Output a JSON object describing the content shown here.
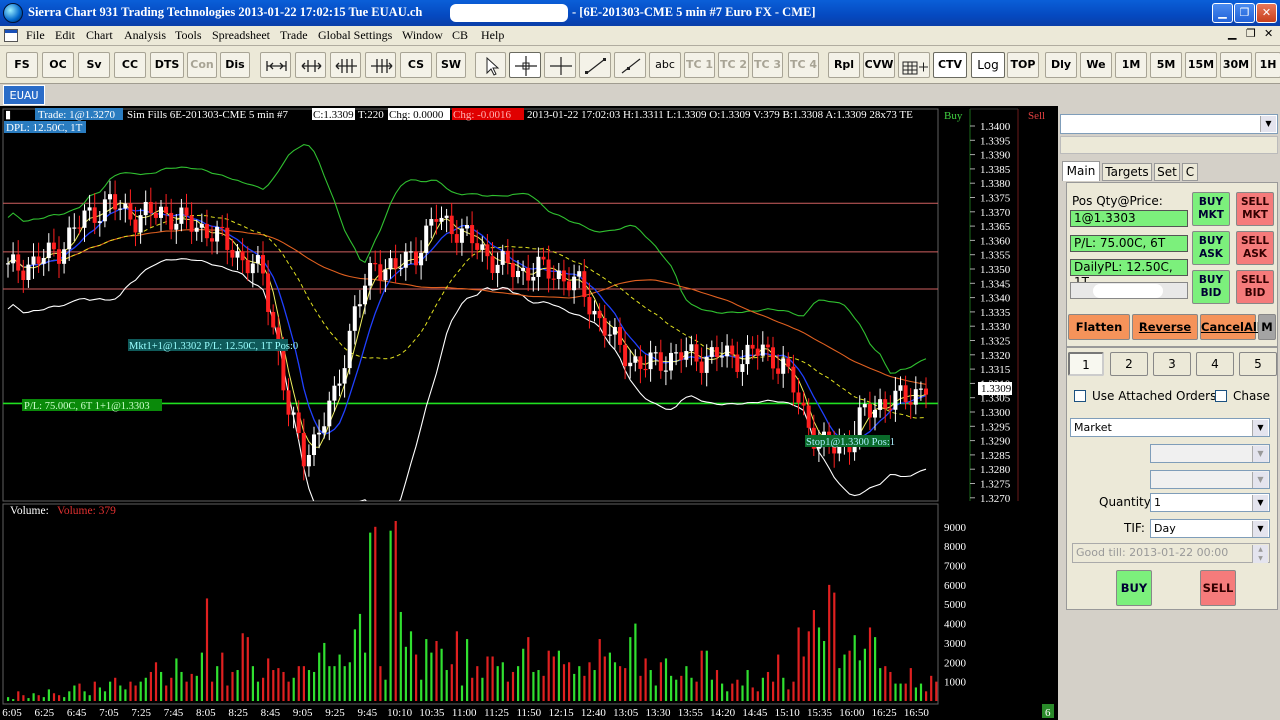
{
  "window": {
    "title_left": "Sierra Chart 931 Trading Technologies 2013-01-22  17:02:15 Tue  EUAU.ch",
    "title_right": "- [6E-201303-CME  5 min   #7  Euro FX - CME]",
    "controls": [
      "minimize-icon",
      "restore-icon",
      "close-icon"
    ]
  },
  "menu": [
    "File",
    "Edit",
    "Chart",
    "Analysis",
    "Tools",
    "Spreadsheet",
    "Trade",
    "Global Settings",
    "Window",
    "CB",
    "Help"
  ],
  "toolbar": {
    "group1": [
      "FS",
      "OC",
      "Sv",
      "CC",
      "DTS",
      "Con",
      "Dis"
    ],
    "group2": [
      "CS",
      "SW"
    ],
    "text_tool": "abc",
    "tc": [
      "TC 1",
      "TC 2",
      "TC 3",
      "TC 4"
    ],
    "group3": [
      "Rpl",
      "CVW"
    ],
    "ctv": "CTV",
    "log": "Log",
    "top": "TOP",
    "periods": [
      "Dly",
      "We",
      "1M",
      "5M",
      "15M",
      "30M",
      "1H"
    ]
  },
  "chart_tab": "EUAU",
  "chart_header": {
    "trade": "Trade: 1@1.3270",
    "sim": "Sim Fills  6E-201303-CME  5 min   #7",
    "close": "C:1.3309",
    "ticks": "T:220",
    "chg": "Chg: 0.0000",
    "chg2": "Chg: -0.0016",
    "stats": "2013-01-22 17:02:03 H:1.3311  L:1.3309  O:1.3309  V:379  B:1.3308  A:1.3309  28x73  TE",
    "dpl": "DPL: 12.50C, 1T",
    "buy": "Buy",
    "sell": "Sell"
  },
  "chart_annotations": {
    "mkt": "Mkt1+1@1.3302 P/L: 12.50C, 1T Pos:0",
    "pl": "P/L: 75.00C, 6T 1+1@1.3303",
    "stop": "Stop1@1.3300 Pos:1",
    "price_marker": "1.3309",
    "volume_label": "Volume:",
    "volume_value": "Volume: 379",
    "page_number": "6"
  },
  "chart_data": {
    "type": "candlestick",
    "symbol": "6E-201303-CME",
    "interval": "5 min",
    "price_axis_labels": [
      "1.3400",
      "1.3395",
      "1.3390",
      "1.3385",
      "1.3380",
      "1.3375",
      "1.3370",
      "1.3365",
      "1.3360",
      "1.3355",
      "1.3350",
      "1.3345",
      "1.3340",
      "1.3335",
      "1.3330",
      "1.3325",
      "1.3320",
      "1.3315",
      "1.3310",
      "1.3305",
      "1.3300",
      "1.3295",
      "1.3290",
      "1.3285",
      "1.3280",
      "1.3275",
      "1.3270"
    ],
    "volume_axis_labels": [
      "9000",
      "8000",
      "7000",
      "6000",
      "5000",
      "4000",
      "3000",
      "2000",
      "1000"
    ],
    "time_labels": [
      "6:05",
      "6:25",
      "6:45",
      "7:05",
      "7:25",
      "7:45",
      "8:05",
      "8:25",
      "8:45",
      "9:05",
      "9:25",
      "9:45",
      "10:10",
      "10:35",
      "11:00",
      "11:25",
      "11:50",
      "12:15",
      "12:40",
      "13:05",
      "13:30",
      "13:55",
      "14:20",
      "14:45",
      "15:10",
      "15:35",
      "16:00",
      "16:25",
      "16:50"
    ],
    "horizontal_levels": [
      1.3373,
      1.3356,
      1.3343
    ],
    "position_level": 1.3303,
    "last_price": 1.3309,
    "close_anchors": [
      [
        0,
        1.335
      ],
      [
        5,
        1.3352
      ],
      [
        10,
        1.3357
      ],
      [
        15,
        1.3368
      ],
      [
        20,
        1.3373
      ],
      [
        25,
        1.3368
      ],
      [
        30,
        1.337
      ],
      [
        35,
        1.3366
      ],
      [
        40,
        1.3363
      ],
      [
        45,
        1.3355
      ],
      [
        50,
        1.3348
      ],
      [
        52,
        1.333
      ],
      [
        55,
        1.33
      ],
      [
        58,
        1.3285
      ],
      [
        61,
        1.3293
      ],
      [
        64,
        1.3305
      ],
      [
        68,
        1.3335
      ],
      [
        72,
        1.3352
      ],
      [
        76,
        1.335
      ],
      [
        80,
        1.3356
      ],
      [
        84,
        1.3368
      ],
      [
        88,
        1.3364
      ],
      [
        92,
        1.3358
      ],
      [
        96,
        1.3352
      ],
      [
        100,
        1.3349
      ],
      [
        104,
        1.335
      ],
      [
        108,
        1.3348
      ],
      [
        112,
        1.3344
      ],
      [
        116,
        1.3332
      ],
      [
        120,
        1.3322
      ],
      [
        124,
        1.3316
      ],
      [
        128,
        1.3318
      ],
      [
        132,
        1.332
      ],
      [
        136,
        1.3319
      ],
      [
        140,
        1.332
      ],
      [
        144,
        1.3319
      ],
      [
        148,
        1.3322
      ],
      [
        152,
        1.3316
      ],
      [
        156,
        1.33
      ],
      [
        159,
        1.3288
      ],
      [
        162,
        1.3288
      ],
      [
        165,
        1.329
      ],
      [
        168,
        1.33
      ],
      [
        171,
        1.3303
      ],
      [
        174,
        1.3304
      ],
      [
        177,
        1.3306
      ],
      [
        180,
        1.3309
      ]
    ],
    "volume_bars": [
      [
        200,
        100,
        500,
        300,
        150,
        400,
        300,
        200,
        600,
        400,
        300,
        200,
        500,
        800,
        900,
        500,
        300,
        1000,
        700,
        500,
        1000,
        1200,
        800,
        600,
        1000,
        800,
        1000,
        1200,
        1500,
        2000,
        1500,
        800,
        1200,
        2200,
        1500,
        1000,
        1400,
        1300,
        2500,
        5300,
        1000,
        1800,
        2500,
        800,
        1500,
        1600,
        3500,
        3300,
        1800,
        1000,
        1200,
        2200,
        1600,
        1700,
        1500,
        1000,
        1200,
        1800,
        1800,
        1600,
        1500,
        2500,
        3000,
        1800,
        1800,
        2400,
        1800,
        2000,
        3700,
        4500,
        2500,
        8700,
        9000,
        1800,
        1100,
        8800,
        9300,
        4600,
        2800,
        3600,
        2400,
        1100,
        3200,
        2500,
        3100,
        2700,
        1600,
        1900,
        3600,
        800,
        3200,
        1200,
        1800,
        1200,
        2300,
        2300,
        1800,
        2000,
        1000,
        1500,
        1800,
        2700,
        3300,
        1500,
        1600,
        1300,
        2600,
        2300,
        2600,
        1900,
        2000,
        1400,
        1800,
        1300,
        2000,
        1600,
        3200,
        2300,
        2500,
        2000,
        1800,
        1700,
        3300,
        4000,
        1300,
        2200,
        1600,
        800,
        2000,
        2200,
        1300,
        1100,
        1300,
        1800,
        1200,
        1000,
        2600,
        2600,
        1100,
        1600,
        900,
        500,
        900,
        1100,
        800,
        1600,
        700,
        500,
        1200,
        1500,
        1000,
        2400,
        1200,
        600,
        1000,
        3800,
        2300,
        3600,
        4700,
        3800,
        3100,
        6000,
        5600,
        1700,
        2400,
        2600,
        3400,
        2100,
        2700,
        3800,
        3300,
        1700,
        1800,
        1500,
        900,
        900,
        900,
        1700,
        700,
        900,
        500,
        1300,
        1000,
        600,
        700,
        500,
        1200,
        500,
        379
      ],
      "red when bar closes down, green when up"
    ]
  },
  "side": {
    "tabs": [
      "Main",
      "Targets",
      "Set",
      "C"
    ],
    "pos_label": "Pos Qty@Price:",
    "pos_value": "1@1.3303",
    "pl_value": "P/L: 75.00C, 6T",
    "daily_pl": "DailyPL: 12.50C, 1T",
    "buttons": {
      "buy_mkt": "BUY MKT",
      "sell_mkt": "SELL MKT",
      "buy_ask": "BUY ASK",
      "sell_ask": "SELL ASK",
      "buy_bid": "BUY BID",
      "sell_bid": "SELL BID",
      "flatten": "Flatten",
      "reverse": "Reverse",
      "cancel_all": "CancelAll",
      "m": "M"
    },
    "quantity_buttons": [
      "1",
      "2",
      "3",
      "4",
      "5"
    ],
    "use_attached": "Use Attached Orders",
    "chase": "Chase",
    "order_type": "Market",
    "quantity_label": "Quantity:",
    "quantity_value": "1",
    "tif_label": "TIF:",
    "tif_value": "Day",
    "good_till": "Good till: 2013-01-22 00:00",
    "buy": "BUY",
    "sell": "SELL"
  }
}
